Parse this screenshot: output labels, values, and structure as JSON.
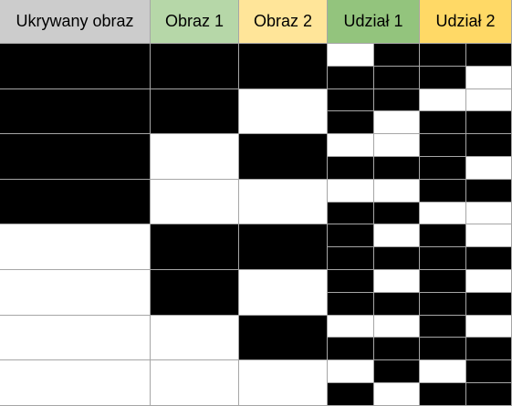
{
  "headers": {
    "hidden": "Ukrywany obraz",
    "image1": "Obraz 1",
    "image2": "Obraz 2",
    "share1": "Udział 1",
    "share2": "Udział 2"
  },
  "colors": {
    "hidden_header": "#cccccc",
    "image1_header": "#b6d7a8",
    "image2_header": "#ffe599",
    "share1_header": "#93c47d",
    "share2_header": "#ffd966",
    "black": "#000000",
    "white": "#ffffff",
    "grid_line": "#a6a6a6"
  },
  "rows": [
    {
      "hidden": "black",
      "image1": "black",
      "image2": "black",
      "share1": [
        [
          "white",
          "black"
        ],
        [
          "black",
          "black"
        ]
      ],
      "share2": [
        [
          "black",
          "black"
        ],
        [
          "black",
          "white"
        ]
      ]
    },
    {
      "hidden": "black",
      "image1": "black",
      "image2": "white",
      "share1": [
        [
          "black",
          "black"
        ],
        [
          "black",
          "white"
        ]
      ],
      "share2": [
        [
          "white",
          "white"
        ],
        [
          "black",
          "black"
        ]
      ]
    },
    {
      "hidden": "black",
      "image1": "white",
      "image2": "black",
      "share1": [
        [
          "white",
          "white"
        ],
        [
          "black",
          "black"
        ]
      ],
      "share2": [
        [
          "black",
          "black"
        ],
        [
          "black",
          "white"
        ]
      ]
    },
    {
      "hidden": "black",
      "image1": "white",
      "image2": "white",
      "share1": [
        [
          "white",
          "white"
        ],
        [
          "black",
          "black"
        ]
      ],
      "share2": [
        [
          "black",
          "black"
        ],
        [
          "white",
          "white"
        ]
      ]
    },
    {
      "hidden": "white",
      "image1": "black",
      "image2": "black",
      "share1": [
        [
          "black",
          "white"
        ],
        [
          "black",
          "black"
        ]
      ],
      "share2": [
        [
          "black",
          "white"
        ],
        [
          "black",
          "black"
        ]
      ]
    },
    {
      "hidden": "white",
      "image1": "black",
      "image2": "white",
      "share1": [
        [
          "black",
          "white"
        ],
        [
          "black",
          "black"
        ]
      ],
      "share2": [
        [
          "black",
          "white"
        ],
        [
          "black",
          "black"
        ]
      ]
    },
    {
      "hidden": "white",
      "image1": "white",
      "image2": "black",
      "share1": [
        [
          "white",
          "white"
        ],
        [
          "black",
          "black"
        ]
      ],
      "share2": [
        [
          "black",
          "white"
        ],
        [
          "black",
          "black"
        ]
      ]
    },
    {
      "hidden": "white",
      "image1": "white",
      "image2": "white",
      "share1": [
        [
          "white",
          "black"
        ],
        [
          "black",
          "white"
        ]
      ],
      "share2": [
        [
          "white",
          "black"
        ],
        [
          "black",
          "black"
        ]
      ]
    }
  ]
}
